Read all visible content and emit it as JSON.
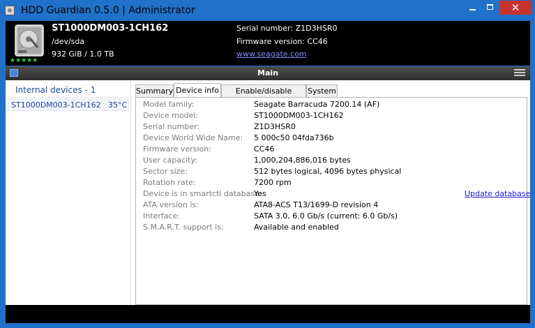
{
  "window": {
    "title": "HDD Guardian 0.5.0 | Administrator",
    "controls": {
      "minimize": "",
      "maximize": "",
      "close": "✕"
    }
  },
  "header": {
    "model": "ST1000DM003-1CH162",
    "device_path": "/dev/sda",
    "capacity": "932 GiB / 1.0 TB",
    "rating_stars": "★★★★★",
    "serial": "Serial number: Z1D3HSR0",
    "firmware": "Firmware version: CC46",
    "website": "www.seagate.com"
  },
  "mainbar": {
    "title": "Main"
  },
  "sidebar": {
    "header": "Internal devices - 1",
    "devices": [
      {
        "name": "ST1000DM003-1CH162",
        "temp": "35°C"
      }
    ]
  },
  "tabs": [
    {
      "label": "Summary",
      "active": false
    },
    {
      "label": "Device info",
      "active": true
    },
    {
      "label": "Enable/disable features",
      "active": false
    },
    {
      "label": "System",
      "active": false
    }
  ],
  "device_info": [
    {
      "label": "Model family:",
      "value": "Seagate Barracuda 7200.14 (AF)"
    },
    {
      "label": "Device model:",
      "value": "ST1000DM003-1CH162"
    },
    {
      "label": "Serial number:",
      "value": "Z1D3HSR0"
    },
    {
      "label": "Device World Wide Name:",
      "value": "5 000c50 04fda736b"
    },
    {
      "label": "Firmware version:",
      "value": "CC46"
    },
    {
      "label": "User capacity:",
      "value": "1,000,204,886,016 bytes"
    },
    {
      "label": "Sector size:",
      "value": "512 bytes logical, 4096 bytes physical"
    },
    {
      "label": "Rotation rate:",
      "value": "7200 rpm"
    },
    {
      "label": "Device is in smartctl database:",
      "value": "Yes"
    },
    {
      "label": "ATA version is:",
      "value": "ATA8-ACS T13/1699-D revision 4"
    },
    {
      "label": "Interface:",
      "value": "SATA 3.0, 6.0 Gb/s (current: 6.0 Gb/s)"
    },
    {
      "label": "S.M.A.R.T. support is:",
      "value": "Available and enabled"
    }
  ],
  "update_database": "Update database",
  "colors": {
    "titlebar": "#1f71c9",
    "close": "#c7322f",
    "stars": "#37d637",
    "link": "#1a1acf"
  }
}
